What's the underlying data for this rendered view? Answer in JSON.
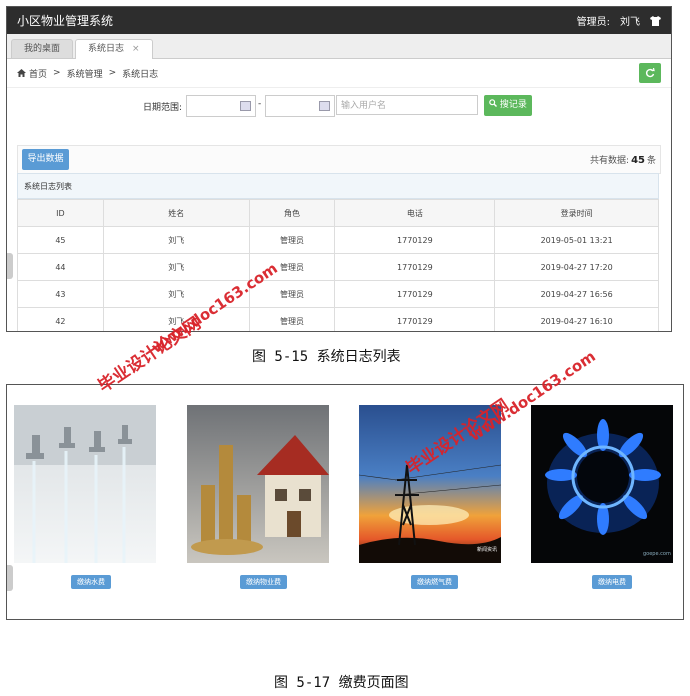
{
  "app": {
    "title": "小区物业管理系统",
    "admin_label": "管理员:",
    "admin_name": "刘飞",
    "shirt_icon": "shirt-icon"
  },
  "tabs": [
    {
      "label": "我的桌面"
    },
    {
      "label": "系统日志",
      "close": "×"
    }
  ],
  "breadcrumb": {
    "home": "首页",
    "sep": ">",
    "level1": "系统管理",
    "level2": "系统日志"
  },
  "filter": {
    "date_label": "日期范围:",
    "dash": "-",
    "user_placeholder": "输入用户名",
    "search_button": "搜记录"
  },
  "toolbar": {
    "export_button": "导出数据",
    "total_prefix": "共有数据:",
    "total_count": "45",
    "total_suffix": "条"
  },
  "list": {
    "title": "系统日志列表",
    "columns": [
      "ID",
      "姓名",
      "角色",
      "电话",
      "登录时间"
    ],
    "rows": [
      [
        "45",
        "刘飞",
        "管理员",
        "1770129",
        "2019-05-01 13:21"
      ],
      [
        "44",
        "刘飞",
        "管理员",
        "1770129",
        "2019-04-27 17:20"
      ],
      [
        "43",
        "刘飞",
        "管理员",
        "1770129",
        "2019-04-27 16:56"
      ],
      [
        "42",
        "刘飞",
        "管理员",
        "1770129",
        "2019-04-27 16:10"
      ]
    ]
  },
  "caption1": "图 5-15 系统日志列表",
  "payments": [
    {
      "button": "缴纳水费",
      "image": "water-faucets"
    },
    {
      "button": "缴纳物业费",
      "image": "house-and-coins"
    },
    {
      "button": "缴纳燃气费",
      "image": "power-tower-sunset",
      "photo_text": "新闻资讯"
    },
    {
      "button": "缴纳电费",
      "image": "gas-flame",
      "photo_text": "goepe.com"
    }
  ],
  "caption2": "图 5-17 缴费页面图",
  "watermarks": [
    {
      "line1": "毕业设计论文网",
      "line2": "www.doc163.com"
    },
    {
      "line1": "毕业设计论文网",
      "line2": "www.doc163.com"
    }
  ],
  "colors": {
    "topbar": "#2d2d2d",
    "green": "#5cb85c",
    "blue": "#5a9bd5",
    "watermark": "#d9232a"
  }
}
